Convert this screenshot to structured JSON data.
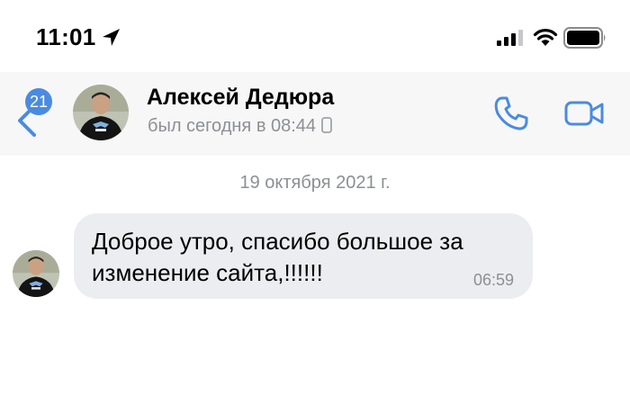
{
  "status_bar": {
    "time": "11:01",
    "icons": [
      "location-arrow-icon",
      "cellular-signal-icon",
      "wifi-icon",
      "battery-icon"
    ]
  },
  "header": {
    "back_icon": "chevron-left-icon",
    "unread_count": "21",
    "contact_name": "Алексей Дедюра",
    "last_seen": "был сегодня в 08:44",
    "last_seen_device_icon": "mobile-phone-icon",
    "call_icon": "phone-icon",
    "video_icon": "video-camera-icon",
    "accent_color": "#4a8be0"
  },
  "chat": {
    "date_separator": "19 октября 2021 г.",
    "messages": [
      {
        "text": "Доброе утро, спасибо большое за изменение сайта,!!!!!!",
        "time": "06:59",
        "incoming": true
      }
    ],
    "bubble_color": "#ebedf0"
  }
}
